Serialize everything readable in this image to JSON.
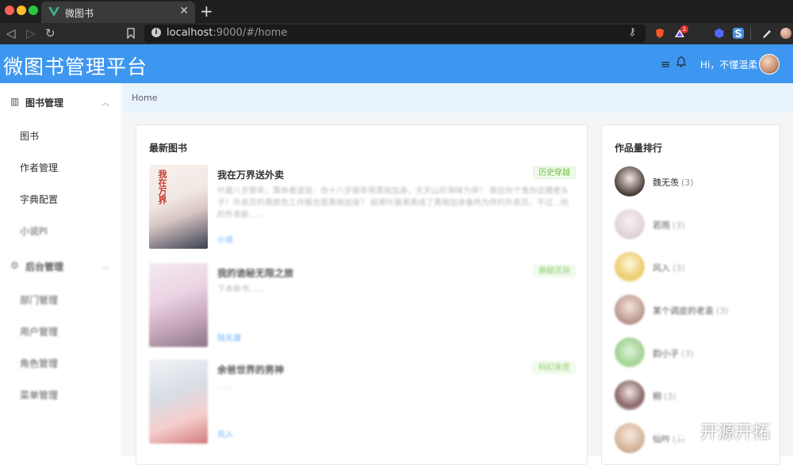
{
  "browser": {
    "tab_title": "微图书",
    "url_host": "localhost",
    "url_rest": ":9000/#/home",
    "ext_badge": "1"
  },
  "header": {
    "app_title": "微图书管理平台",
    "greeting": "Hi，不懂温柔"
  },
  "sidebar": {
    "groups": [
      {
        "label": "图书管理",
        "items": [
          "图书",
          "作者管理",
          "字典配置",
          "小说PI"
        ]
      },
      {
        "label": "后台管理",
        "items": [
          "部门管理",
          "用户管理",
          "角色管理",
          "菜单管理"
        ]
      }
    ]
  },
  "breadcrumb": "Home",
  "latest": {
    "title": "最新图书",
    "books": [
      {
        "title": "我在万界送外卖",
        "tag": "历史穿越",
        "desc": "叶晨八岁那年，算命者道说：你十八岁那年将黄袍加身，天天山珍海味为伴！ 我信你个鬼你这糟老头子！外卖员的黄颜色工作服也是黄袍加身？ 结果叶晨果真成了黄袍加身备肉为伴的外卖员。不过...他的外卖能……",
        "author": "小说",
        "cover_text": "我在万界"
      },
      {
        "title": "我的诡秘无限之旅",
        "tag": "悬疑灵异",
        "desc": "下本新书……",
        "author": "陆无渡",
        "cover_text": ""
      },
      {
        "title": "余爸世界的男神",
        "tag": "科幻末世",
        "desc": "……",
        "author": "风入",
        "cover_text": ""
      }
    ]
  },
  "ranking": {
    "title": "作品量排行",
    "items": [
      {
        "name": "魏无羡",
        "count": "(3)"
      },
      {
        "name": "若雨",
        "count": "(3)"
      },
      {
        "name": "风入",
        "count": "(3)"
      },
      {
        "name": "某个调皮的老袁",
        "count": "(3)"
      },
      {
        "name": "韵小子",
        "count": "(3)"
      },
      {
        "name": "桐",
        "count": "(3)"
      },
      {
        "name": "仙吟",
        "count": "(3)"
      }
    ]
  },
  "watermark": "开源开拓",
  "colors": {
    "header_bg": "#3d97f0",
    "breadcrumb_bg": "#e9f3fd",
    "tag_green": "#67c23a",
    "author_link": "#409eff"
  }
}
